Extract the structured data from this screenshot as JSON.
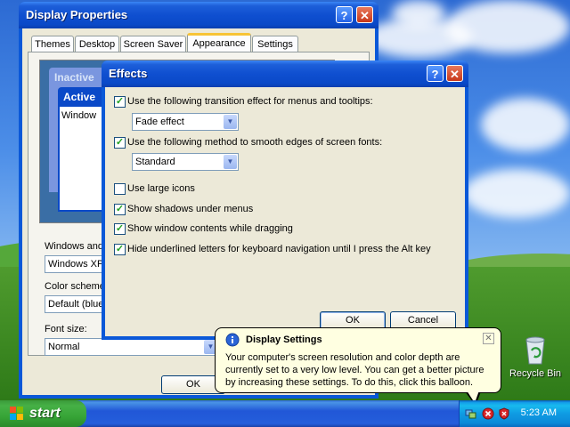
{
  "display_properties": {
    "title": "Display Properties",
    "tabs": [
      "Themes",
      "Desktop",
      "Screen Saver",
      "Appearance",
      "Settings"
    ],
    "active_tab": "Appearance",
    "preview": {
      "inactive_label": "Inactive",
      "active_label": "Active",
      "window_text": "Window"
    },
    "windows_and_label": "Windows and",
    "windows_style_value": "Windows XP",
    "color_scheme_label": "Color scheme:",
    "color_scheme_value": "Default (blue)",
    "font_size_label": "Font size:",
    "font_size_value": "Normal",
    "ok_label": "OK"
  },
  "effects": {
    "title": "Effects",
    "options": [
      {
        "label": "Use the following transition effect for menus and tooltips:",
        "checked": true
      },
      {
        "label": "Use the following method to smooth edges of screen fonts:",
        "checked": true
      },
      {
        "label": "Use large icons",
        "checked": false
      },
      {
        "label": "Show shadows under menus",
        "checked": true
      },
      {
        "label": "Show window contents while dragging",
        "checked": true
      },
      {
        "label": "Hide underlined letters for keyboard navigation until I press the Alt key",
        "checked": true
      }
    ],
    "transition_value": "Fade effect",
    "smoothing_value": "Standard",
    "ok_label": "OK",
    "cancel_label": "Cancel"
  },
  "balloon": {
    "title": "Display Settings",
    "body": "Your computer's screen resolution and color depth are currently set to a very low level. You can get a better picture by increasing these settings. To do this, click this balloon."
  },
  "desktop": {
    "recycle_bin_label": "Recycle Bin"
  },
  "taskbar": {
    "start_label": "start",
    "clock": "5:23 AM"
  },
  "colors": {
    "title_blue": "#0a49c8",
    "dialog_bg": "#ece9d8",
    "start_green": "#37a537",
    "balloon_bg": "#ffffe1"
  }
}
